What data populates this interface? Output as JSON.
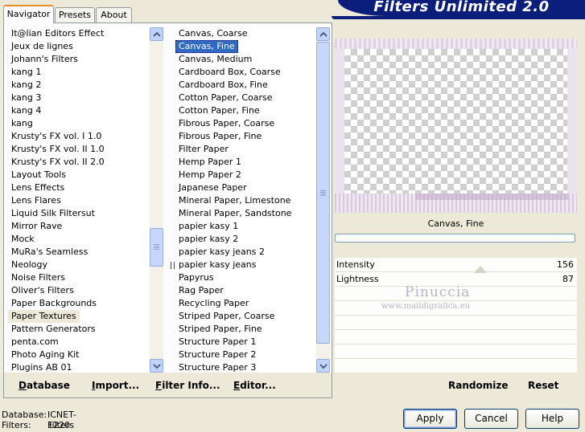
{
  "app": {
    "banner_title": "Filters Unlimited 2.0"
  },
  "tabs": [
    {
      "label": "Navigator",
      "active": true
    },
    {
      "label": "Presets",
      "active": false
    },
    {
      "label": "About",
      "active": false
    }
  ],
  "categories": {
    "items": [
      "It@lian Editors Effect",
      "Jeux de lignes",
      "Johann's Filters",
      "kang 1",
      "kang 2",
      "kang 3",
      "kang 4",
      "kang",
      "Krusty's FX vol. I 1.0",
      "Krusty's FX vol. II 1.0",
      "Krusty's FX vol. II 2.0",
      "Layout Tools",
      "Lens Effects",
      "Lens Flares",
      "Liquid Silk Filtersut",
      "Mirror Rave",
      "Mock",
      "MuRa's Seamless",
      "Neology",
      "Noise Filters",
      "Oliver's Filters",
      "Paper Backgrounds",
      "Paper Textures",
      "Pattern Generators",
      "penta.com",
      "Photo Aging Kit",
      "Plugins AB 01"
    ],
    "selected": "Paper Textures"
  },
  "filters": {
    "items": [
      "Canvas, Coarse",
      "Canvas, Fine",
      "Canvas, Medium",
      "Cardboard Box, Coarse",
      "Cardboard Box, Fine",
      "Cotton Paper, Coarse",
      "Cotton Paper, Fine",
      "Fibrous Paper, Coarse",
      "Fibrous Paper, Fine",
      "Filter Paper",
      "Hemp Paper 1",
      "Hemp Paper 2",
      "Japanese Paper",
      "Mineral Paper, Limestone",
      "Mineral Paper, Sandstone",
      "papier kasy 1",
      "papier kasy 2",
      "papier kasy jeans 2",
      "papier kasy jeans",
      "Papyrus",
      "Rag Paper",
      "Recycling Paper",
      "Striped Paper, Coarse",
      "Striped Paper, Fine",
      "Structure Paper 1",
      "Structure Paper 2",
      "Structure Paper 3"
    ],
    "selected": "Canvas, Fine"
  },
  "panel_buttons": {
    "database": "Database",
    "import": "Import...",
    "filter_info": "Filter Info...",
    "editor": "Editor..."
  },
  "preview": {
    "filter_name": "Canvas, Fine",
    "progress": 0
  },
  "parameters": [
    {
      "label": "Intensity",
      "value": "156"
    },
    {
      "label": "Lightness",
      "value": "87"
    }
  ],
  "watermark": {
    "name": "Pinuccia",
    "site": "www.maildigrafica.eu"
  },
  "param_buttons": {
    "randomize": "Randomize",
    "reset": "Reset"
  },
  "status": {
    "database_label": "Database:",
    "database_value": "ICNET-Filters",
    "filters_label": "Filters:",
    "filters_value": "1220"
  },
  "dialog_buttons": {
    "apply": "Apply",
    "cancel": "Cancel",
    "help": "Help"
  }
}
